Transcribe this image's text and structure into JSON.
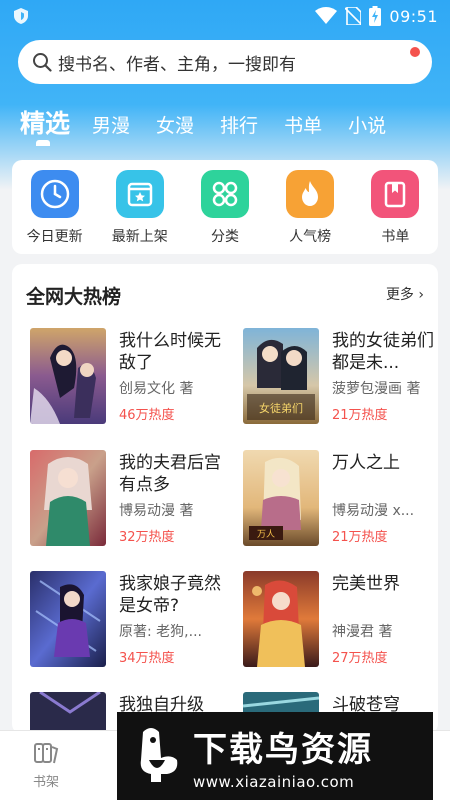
{
  "status_bar": {
    "time": "09:51",
    "icons": [
      "shield-icon",
      "wifi-icon",
      "no-sim-icon",
      "battery-charging-icon"
    ]
  },
  "search": {
    "placeholder": "搜书名、作者、主角，一搜即有",
    "icon": "search-icon"
  },
  "tabs": [
    {
      "label": "精选",
      "active": true
    },
    {
      "label": "男漫"
    },
    {
      "label": "女漫"
    },
    {
      "label": "排行"
    },
    {
      "label": "书单"
    },
    {
      "label": "小说"
    }
  ],
  "quick_menu": [
    {
      "label": "今日更新",
      "icon": "clock-icon",
      "color": "#3d8cf0"
    },
    {
      "label": "最新上架",
      "icon": "new-box-icon",
      "color": "#37c3e8"
    },
    {
      "label": "分类",
      "icon": "grid-icon",
      "color": "#2ed39b"
    },
    {
      "label": "人气榜",
      "icon": "flame-icon",
      "color": "#f7a235"
    },
    {
      "label": "书单",
      "icon": "bookmark-book-icon",
      "color": "#f2547a"
    }
  ],
  "ranking": {
    "title": "全网大热榜",
    "more_label": "更多",
    "books": [
      {
        "title": "我什么时候无敌了",
        "author": "创易文化 著",
        "heat": "46万热度"
      },
      {
        "title": "我的女徒弟们都是未...",
        "author": "菠萝包漫画 著",
        "heat": "21万热度"
      },
      {
        "title": "我的夫君后宫有点多",
        "author": "博易动漫 著",
        "heat": "32万热度"
      },
      {
        "title": "万人之上",
        "author": "博易动漫 x...",
        "heat": "21万热度"
      },
      {
        "title": "我家娘子竟然是女帝?",
        "author": "原著: 老狗,...",
        "heat": "34万热度"
      },
      {
        "title": "完美世界",
        "author": "神漫君 著",
        "heat": "27万热度"
      },
      {
        "title": "我独自升级",
        "author": "",
        "heat": ""
      },
      {
        "title": "斗破苍穹",
        "author": "",
        "heat": ""
      }
    ]
  },
  "bottom_nav": {
    "bookshelf_label": "书架"
  },
  "watermark": {
    "main": "下载鸟资源",
    "url": "www.xiazainiao.com"
  },
  "colors": {
    "accent": "#2fa8f5",
    "heat": "#f4524d"
  }
}
